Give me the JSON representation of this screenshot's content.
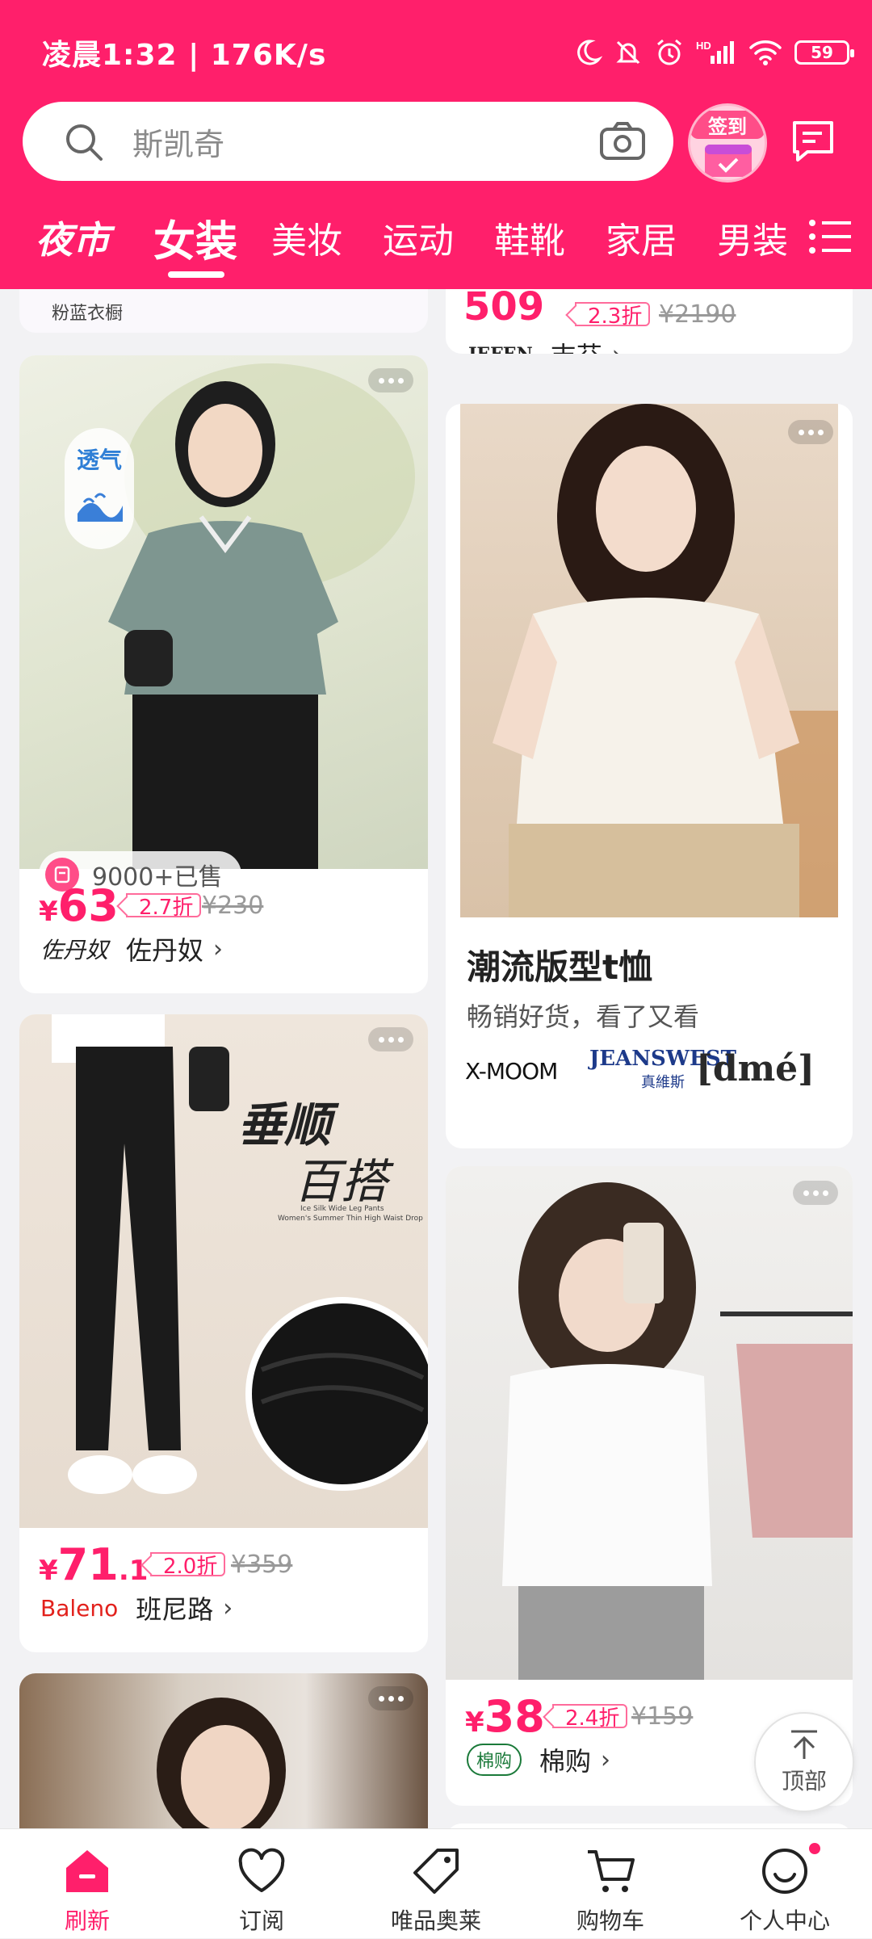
{
  "status_bar": {
    "time": "凌晨1:32 | 176K/s",
    "battery": "59"
  },
  "search": {
    "placeholder": "斯凯奇"
  },
  "signin": {
    "label": "签到"
  },
  "tabs": [
    {
      "label": "夜市"
    },
    {
      "label": "女装",
      "active": true
    },
    {
      "label": "美妆"
    },
    {
      "label": "运动"
    },
    {
      "label": "鞋靴"
    },
    {
      "label": "家居"
    },
    {
      "label": "男装"
    }
  ],
  "feed": {
    "partial_left": {
      "brand_logo_text": "粉蓝衣橱"
    },
    "partial_right": {
      "price": "509",
      "discount": "2.3折",
      "original": "¥2190",
      "brand_logo": "JEFEN",
      "brand": "吉芬"
    },
    "products": [
      {
        "price_int": "63",
        "price_dec": "",
        "discount": "2.7折",
        "original": "¥230",
        "brand_logo": "佐丹奴",
        "brand": "佐丹奴",
        "sold": "9000+已售",
        "badge": "透气"
      },
      {
        "price_int": "71",
        "price_dec": ".1",
        "discount": "2.0折",
        "original": "¥359",
        "brand_logo": "Baleno",
        "brand": "班尼路",
        "overlay_title": "垂顺",
        "overlay_sub": "百搭",
        "overlay_caption_1": "Ice Silk Wide Leg Pants",
        "overlay_caption_2": "Women's Summer Thin High Waist Drop"
      },
      {
        "price_int": "38",
        "price_dec": "",
        "discount": "2.4折",
        "original": "¥159",
        "brand_logo": "棉购",
        "brand": "棉购"
      }
    ],
    "promo": {
      "title": "潮流版型t恤",
      "subtitle": "畅销好货，看了又看",
      "brands": [
        "X-MOOM",
        "JEANSWEST",
        "[dmé]"
      ],
      "brand_sub": "真維斯"
    }
  },
  "back_to_top": {
    "label": "顶部"
  },
  "bottom_nav": [
    {
      "label": "刷新",
      "active": true
    },
    {
      "label": "订阅"
    },
    {
      "label": "唯品奥莱"
    },
    {
      "label": "购物车"
    },
    {
      "label": "个人中心"
    }
  ],
  "colors": {
    "brand": "#ff1f6b",
    "price": "#ff1f6b",
    "background": "#f2f2f4"
  }
}
